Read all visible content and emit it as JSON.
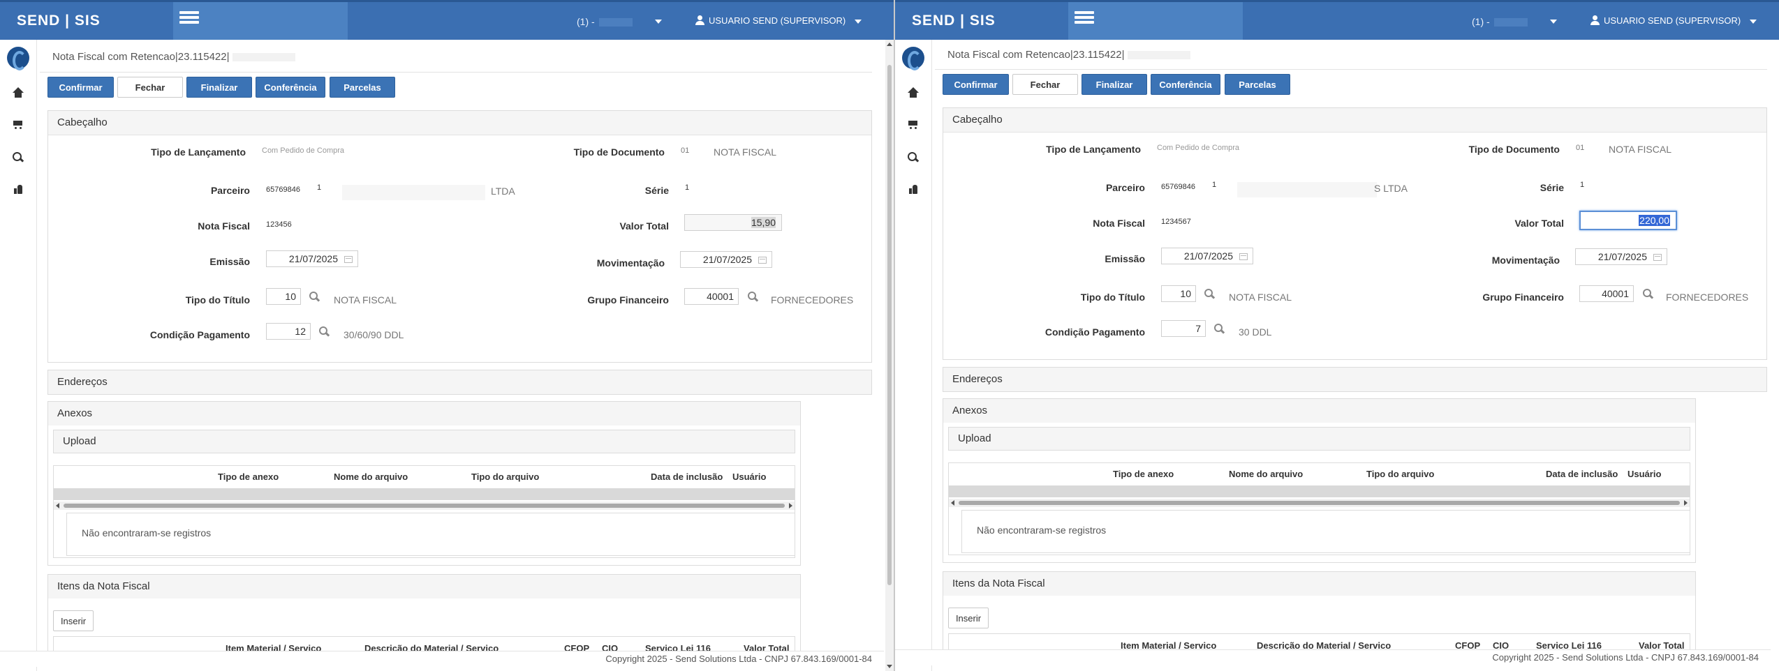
{
  "app": {
    "brand": "SEND | SIS"
  },
  "panes": [
    {
      "header": {
        "unit": "(1) -",
        "user": "USUARIO SEND (SUPERVISOR)"
      },
      "page_title": "Nota Fiscal com Retencao|23.115422|",
      "toolbar": {
        "confirmar": "Confirmar",
        "fechar": "Fechar",
        "finalizar": "Finalizar",
        "conferencia": "Conferência",
        "parcelas": "Parcelas"
      },
      "cabecalho": {
        "title": "Cabeçalho",
        "tipo_lancamento_label": "Tipo de Lançamento",
        "tipo_lancamento": "Com Pedido de Compra",
        "tipo_documento_label": "Tipo de Documento",
        "tipo_documento_code": "01",
        "tipo_documento_name": "NOTA FISCAL",
        "parceiro_label": "Parceiro",
        "parceiro_code": "65769846",
        "parceiro_num": "1",
        "parceiro_suffix": "LTDA",
        "serie_label": "Série",
        "serie": "1",
        "nota_fiscal_label": "Nota Fiscal",
        "nota_fiscal": "123456",
        "valor_total_label": "Valor Total",
        "valor_total": "15,90",
        "emissao_label": "Emissão",
        "emissao": "21/07/2025",
        "movimentacao_label": "Movimentação",
        "movimentacao": "21/07/2025",
        "tipo_titulo_label": "Tipo do Título",
        "tipo_titulo_code": "10",
        "tipo_titulo_name": "NOTA FISCAL",
        "grupo_financeiro_label": "Grupo Financeiro",
        "grupo_financeiro_code": "40001",
        "grupo_financeiro_name": "FORNECEDORES",
        "condicao_label": "Condição Pagamento",
        "condicao_code": "12",
        "condicao_name": "30/60/90 DDL"
      },
      "enderecos_title": "Endereços",
      "anexos": {
        "title": "Anexos",
        "upload_title": "Upload",
        "columns": [
          "Tipo de anexo",
          "Nome do arquivo",
          "Tipo do arquivo",
          "Data de inclusão",
          "Usuário"
        ],
        "empty": "Não encontraram-se registros"
      },
      "itens": {
        "title": "Itens da Nota Fiscal",
        "inserir": "Inserir",
        "columns": [
          "Item Material / Serviço",
          "Descrição do Material / Serviço",
          "CFOP",
          "CIO",
          "Serviço Lei 116",
          "Valor Total"
        ]
      },
      "footer": "Copyright 2025 - Send Solutions Ltda - CNPJ 67.843.169/0001-84"
    },
    {
      "header": {
        "unit": "(1) -",
        "user": "USUARIO SEND (SUPERVISOR)"
      },
      "page_title": "Nota Fiscal com Retencao|23.115422|",
      "toolbar": {
        "confirmar": "Confirmar",
        "fechar": "Fechar",
        "finalizar": "Finalizar",
        "conferencia": "Conferência",
        "parcelas": "Parcelas"
      },
      "cabecalho": {
        "title": "Cabeçalho",
        "tipo_lancamento_label": "Tipo de Lançamento",
        "tipo_lancamento": "Com Pedido de Compra",
        "tipo_documento_label": "Tipo de Documento",
        "tipo_documento_code": "01",
        "tipo_documento_name": "NOTA FISCAL",
        "parceiro_label": "Parceiro",
        "parceiro_code": "65769846",
        "parceiro_num": "1",
        "parceiro_suffix": "S LTDA",
        "serie_label": "Série",
        "serie": "1",
        "nota_fiscal_label": "Nota Fiscal",
        "nota_fiscal": "1234567",
        "valor_total_label": "Valor Total",
        "valor_total": "220,00",
        "emissao_label": "Emissão",
        "emissao": "21/07/2025",
        "movimentacao_label": "Movimentação",
        "movimentacao": "21/07/2025",
        "tipo_titulo_label": "Tipo do Título",
        "tipo_titulo_code": "10",
        "tipo_titulo_name": "NOTA FISCAL",
        "grupo_financeiro_label": "Grupo Financeiro",
        "grupo_financeiro_code": "40001",
        "grupo_financeiro_name": "FORNECEDORES",
        "condicao_label": "Condição Pagamento",
        "condicao_code": "7",
        "condicao_name": "30 DDL"
      },
      "enderecos_title": "Endereços",
      "anexos": {
        "title": "Anexos",
        "upload_title": "Upload",
        "columns": [
          "Tipo de anexo",
          "Nome do arquivo",
          "Tipo do arquivo",
          "Data de inclusão",
          "Usuário"
        ],
        "empty": "Não encontraram-se registros"
      },
      "itens": {
        "title": "Itens da Nota Fiscal",
        "inserir": "Inserir",
        "columns": [
          "Item Material / Servico",
          "Descrição do Material / Servico",
          "CFOP",
          "CIO",
          "Servico Lei 116",
          "Valor Total"
        ]
      },
      "footer": "Copyright 2025 - Send Solutions Ltda - CNPJ 67.843.169/0001-84"
    }
  ],
  "colors": {
    "topbar": "#3b6fb2",
    "hamburger_area": "#4c82c2",
    "primary_button": "#3b73b5",
    "focus_border": "#5b8fd6"
  }
}
